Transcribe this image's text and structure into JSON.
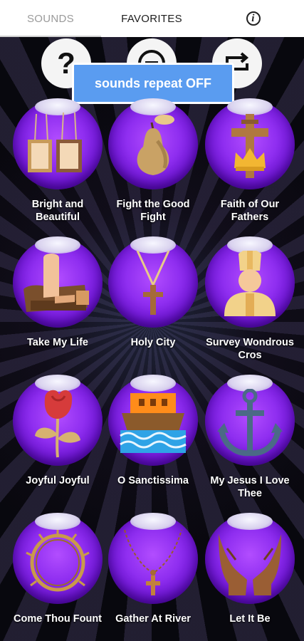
{
  "tabs": {
    "sounds": "SOUNDS",
    "favorites": "FAVORITES",
    "info_glyph": "i"
  },
  "controls": {
    "help_glyph": "?",
    "toast": "sounds repeat OFF"
  },
  "sounds": [
    {
      "label": "Bright and Beautiful",
      "icon": "picture-frames-icon"
    },
    {
      "label": "Fight the Good Fight",
      "icon": "pear-icon"
    },
    {
      "label": "Faith of Our Fathers",
      "icon": "cross-crown-icon"
    },
    {
      "label": "Take My Life",
      "icon": "hand-on-bible-icon"
    },
    {
      "label": "Holy City",
      "icon": "cross-necklace-icon"
    },
    {
      "label": "Survey Wondrous Cros",
      "icon": "bishop-icon"
    },
    {
      "label": "Joyful Joyful",
      "icon": "rose-icon"
    },
    {
      "label": "O Sanctissima",
      "icon": "noahs-ark-icon"
    },
    {
      "label": "My Jesus I Love Thee",
      "icon": "anchor-icon"
    },
    {
      "label": "Come Thou Fount",
      "icon": "crown-of-thorns-icon"
    },
    {
      "label": "Gather At River",
      "icon": "rosary-icon"
    },
    {
      "label": "Let It Be",
      "icon": "praying-hands-icon"
    }
  ],
  "colors": {
    "orb": "#8f2ef0",
    "toast": "#5a9cf0",
    "background": "#08070c"
  }
}
